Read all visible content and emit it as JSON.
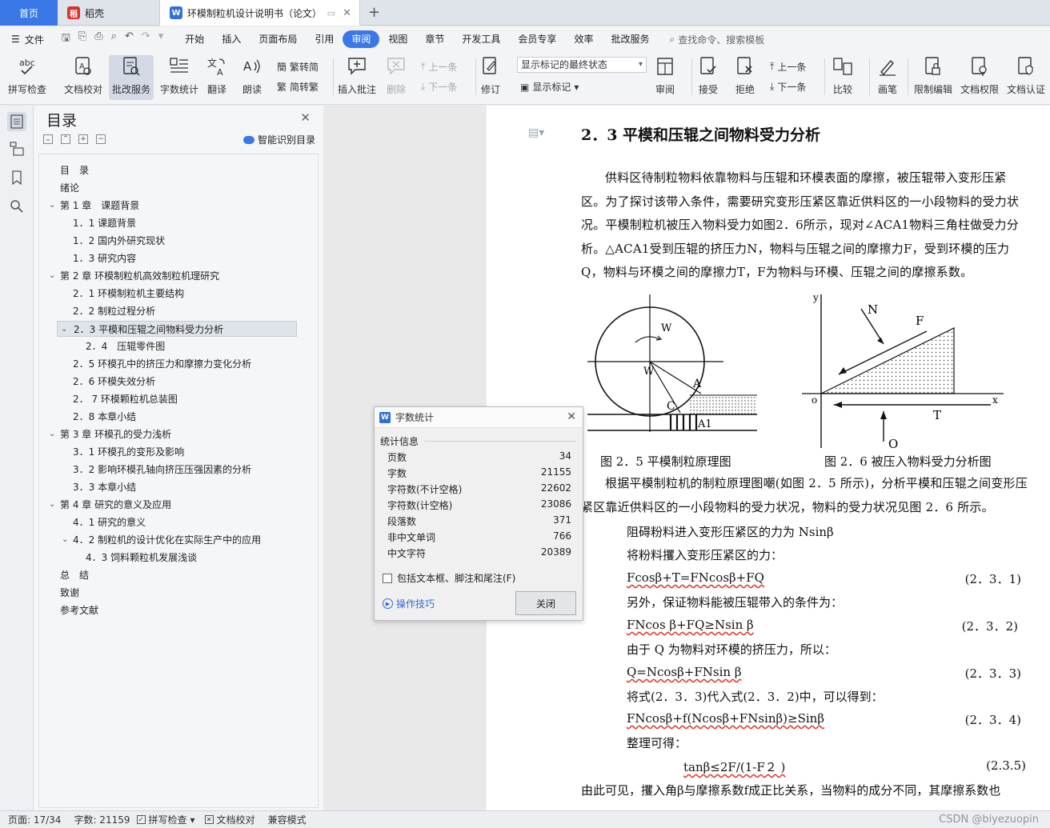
{
  "tabs": {
    "home": "首页",
    "doc1": "稻壳",
    "doc2": "环模制粒机设计说明书（论文）",
    "add": "+"
  },
  "menubar": {
    "file": "文件",
    "items": [
      "开始",
      "插入",
      "页面布局",
      "引用",
      "审阅",
      "视图",
      "章节",
      "开发工具",
      "会员专享",
      "效率",
      "批改服务"
    ],
    "active": "审阅",
    "search": "查找命令、搜索模板"
  },
  "ribbon": {
    "spellcheck": "拼写检查",
    "doc_proofread": "文档校对",
    "correction_service": "批改服务",
    "word_count": "字数统计",
    "translate": "翻译",
    "read_aloud": "朗读",
    "to_traditional": "繁转简",
    "to_simplified": "简转繁",
    "insert_comment": "插入批注",
    "delete": "删除",
    "prev_comment": "上一条",
    "next_comment": "下一条",
    "track": "修订",
    "markup_state": "显示标记的最终状态",
    "show_markup": "显示标记",
    "review": "审阅",
    "accept": "接受",
    "reject": "拒绝",
    "prev_change": "上一条",
    "next_change": "下一条",
    "compare": "比较",
    "pen": "画笔",
    "restrict_edit": "限制编辑",
    "doc_permission": "文档权限",
    "doc_certify": "文档认证"
  },
  "toc": {
    "title": "目录",
    "smart": "智能识别目录",
    "items": [
      {
        "text": "目　录",
        "level": 0,
        "chev": ""
      },
      {
        "text": "绪论",
        "level": 0,
        "chev": ""
      },
      {
        "text": "第 1 章　课题背景",
        "level": 0,
        "chev": "v"
      },
      {
        "text": "1．1 课题背景",
        "level": 1,
        "chev": ""
      },
      {
        "text": "1．2 国内外研究现状",
        "level": 1,
        "chev": ""
      },
      {
        "text": "1．3 研究内容",
        "level": 1,
        "chev": ""
      },
      {
        "text": "第 2 章  环模制粒机高效制粒机理研究",
        "level": 0,
        "chev": "v"
      },
      {
        "text": "2．1 环模制粒机主要结构",
        "level": 1,
        "chev": ""
      },
      {
        "text": "2．2 制粒过程分析",
        "level": 1,
        "chev": ""
      },
      {
        "text": "2．3 平模和压辊之间物料受力分析",
        "level": 1,
        "chev": "v",
        "selected": true
      },
      {
        "text": "2．4　压辊零件图",
        "level": 2,
        "chev": ""
      },
      {
        "text": "2．5 环模孔中的挤压力和摩擦力变化分析",
        "level": 1,
        "chev": ""
      },
      {
        "text": "2．6 环模失效分析",
        "level": 1,
        "chev": ""
      },
      {
        "text": "2．  7 环模颗粒机总装图",
        "level": 1,
        "chev": ""
      },
      {
        "text": "2．8 本章小结",
        "level": 1,
        "chev": ""
      },
      {
        "text": "第 3 章  环模孔的受力浅析",
        "level": 0,
        "chev": "v"
      },
      {
        "text": "3．1 环模孔的变形及影响",
        "level": 1,
        "chev": ""
      },
      {
        "text": "3．2 影响环模孔轴向挤压压强因素的分析",
        "level": 1,
        "chev": ""
      },
      {
        "text": "3．3 本章小结",
        "level": 1,
        "chev": ""
      },
      {
        "text": "第 4 章  研究的意义及应用",
        "level": 0,
        "chev": "v"
      },
      {
        "text": "4．1  研究的意义",
        "level": 1,
        "chev": ""
      },
      {
        "text": "4．2  制粒机的设计优化在实际生产中的应用",
        "level": 1,
        "chev": "v"
      },
      {
        "text": "4．3 饲料颗粒机发展浅谈",
        "level": 2,
        "chev": ""
      },
      {
        "text": "总　结",
        "level": 0,
        "chev": ""
      },
      {
        "text": "致谢",
        "level": 0,
        "chev": ""
      },
      {
        "text": "参考文献",
        "level": 0,
        "chev": ""
      }
    ]
  },
  "doc": {
    "heading": "2．3 平模和压辊之间物料受力分析",
    "para1": "供料区待制粒物料依靠物料与压辊和环模表面的摩擦，被压辊带入变形压紧区。为了探讨该带入条件，需要研究变形压紧区靠近供料区的一小段物料的受力状况。平模制粒机被压入物料受力如图2．6所示，现对∠ACA1物料三角柱做受力分析。△ACA1受到压辊的挤压力N，物料与压辊之间的摩擦力F，受到环模的压力Q，物料与环模之间的摩擦力T，F为物料与环模、压辊之间的摩擦系数。",
    "fig_left_caption": "图 2．5 平模制粒原理图",
    "fig_right_caption": "图 2．6 被压入物料受力分析图",
    "para2": "根据平模制粒机的制粒原理图嘲(如图 2．5 所示)，分析平模和压辊之间变形压紧区靠近供料区的一小段物料的受力状况，物料的受力状况见图 2．6 所示。",
    "line1": "阻碍粉料进入变形压紧区的力为 Nsinβ",
    "line2": "将粉料攫入变形压紧区的力：",
    "eq1": "Fcosβ+T=FNcosβ+FQ",
    "eq1_num": "(2．3．1)",
    "line3": "另外，保证物料能被压辊带入的条件为：",
    "eq2": "FNcos β+FQ≥Nsin β",
    "eq2_num": "(2．3．2)",
    "line4": "由于 Q 为物料对环模的挤压力，所以：",
    "eq3": "Q=Ncosβ+FNsin β",
    "eq3_num": "(2．3．3)",
    "line5": "将式(2．3．3)代入式(2．3．2)中，可以得到：",
    "eq4": "FNcosβ+f(Ncosβ+FNsinβ)≥Sinβ",
    "eq4_num": "(2．3．4)",
    "line6": "整理可得：",
    "eq5": "tanβ≤2F/(1-F２ )",
    "eq5_num": "(2.3.5)",
    "para3": "由此可见，攫入角β与摩擦系数f成正比关系，当物料的成分不同，其摩擦系数也"
  },
  "figure": {
    "left_labels": [
      "W",
      "W",
      "A",
      "C",
      "A1"
    ],
    "right_labels": [
      "y",
      "N",
      "F",
      "o",
      "x",
      "T",
      "O"
    ]
  },
  "dialog": {
    "title": "字数统计",
    "section": "统计信息",
    "rows": [
      {
        "label": "页数",
        "value": "34"
      },
      {
        "label": "字数",
        "value": "21155"
      },
      {
        "label": "字符数(不计空格)",
        "value": "22602"
      },
      {
        "label": "字符数(计空格)",
        "value": "23086"
      },
      {
        "label": "段落数",
        "value": "371"
      },
      {
        "label": "非中文单词",
        "value": "766"
      },
      {
        "label": "中文字符",
        "value": "20389"
      }
    ],
    "checkbox": "包括文本框、脚注和尾注(F)",
    "tips": "操作技巧",
    "close": "关闭"
  },
  "status": {
    "page": "页面: 17/34",
    "words": "字数: 21159",
    "spell": "拼写检查",
    "proof": "文档校对",
    "compat": "兼容模式",
    "watermark": "CSDN @biyezuopin"
  },
  "colors": {
    "accent": "#3a78e8",
    "wps_red": "#d9312b",
    "link": "#2e6ad6"
  }
}
